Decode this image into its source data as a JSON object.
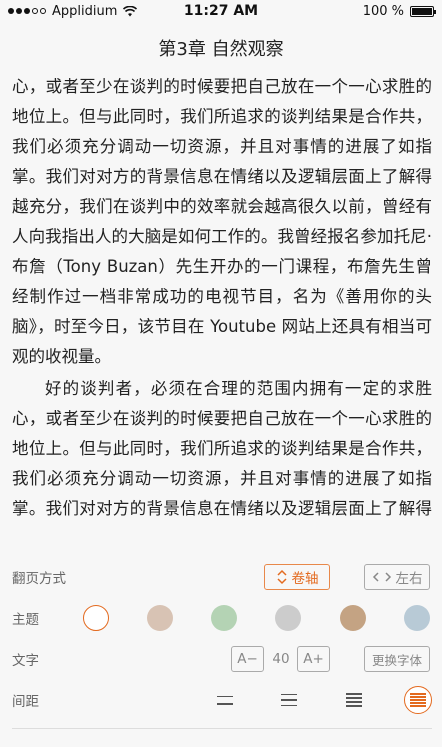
{
  "status_bar": {
    "carrier": "Applidium",
    "time": "11:27 AM",
    "battery": "100 %",
    "battery_level": 1.0
  },
  "header": {
    "title": "第3章 自然观察"
  },
  "content": {
    "paragraphs": [
      "心，或者至少在谈判的时候要把自己放在一个一心求胜的地位上。但与此同时，我们所追求的谈判结果是合作共，我们必须充分调动一切资源，并且对事情的进展了如指掌。我们对对方的背景信息在情绪以及逻辑层面上了解得越充分，我们在谈判中的效率就会越高很久以前，曾经有人向我指出人的大脑是如何工作的。我曾经报名参加托尼·布詹（Tony Buzan）先生开办的一门课程，布詹先生曾经制作过一档非常成功的电视节目，名为《善用你的头脑》，时至今日，该节目在 Youtube 网站上还具有相当可观的收视量。",
      "好的谈判者，必须在合理的范围内拥有一定的求胜心，或者至少在谈判的时候要把自己放在一个一心求胜的地位上。但与此同时，我们所追求的谈判结果是合作共，我们必须充分调动一切资源，并且对事情的进展了如指掌。我们对对方的背景信息在情绪以及逻辑层面上了解得越充分，我们在谈判中的效率就会越高很久以前，曾经有人向我指出人的大脑是如何工作的。我曾经报名参加托尼·布詹（Tony Buzan）先生开办的一门课程，布詹先生曾经"
    ]
  },
  "settings": {
    "page_turn": {
      "label": "翻页方式",
      "option_scroll": "卷轴",
      "option_lr": "左右",
      "selected": "卷轴"
    },
    "theme": {
      "label": "主题",
      "swatches": [
        "#ffffff",
        "#d8c3b4",
        "#b4d3b4",
        "#cccccc",
        "#c4a383",
        "#b8cad6"
      ],
      "selected_index": 0
    },
    "font": {
      "label": "文字",
      "decrease": "A−",
      "size": "40",
      "increase": "A+",
      "change_font": "更换字体"
    },
    "spacing": {
      "label": "间距",
      "selected_index": 3
    }
  },
  "colors": {
    "accent": "#e36a1f"
  }
}
